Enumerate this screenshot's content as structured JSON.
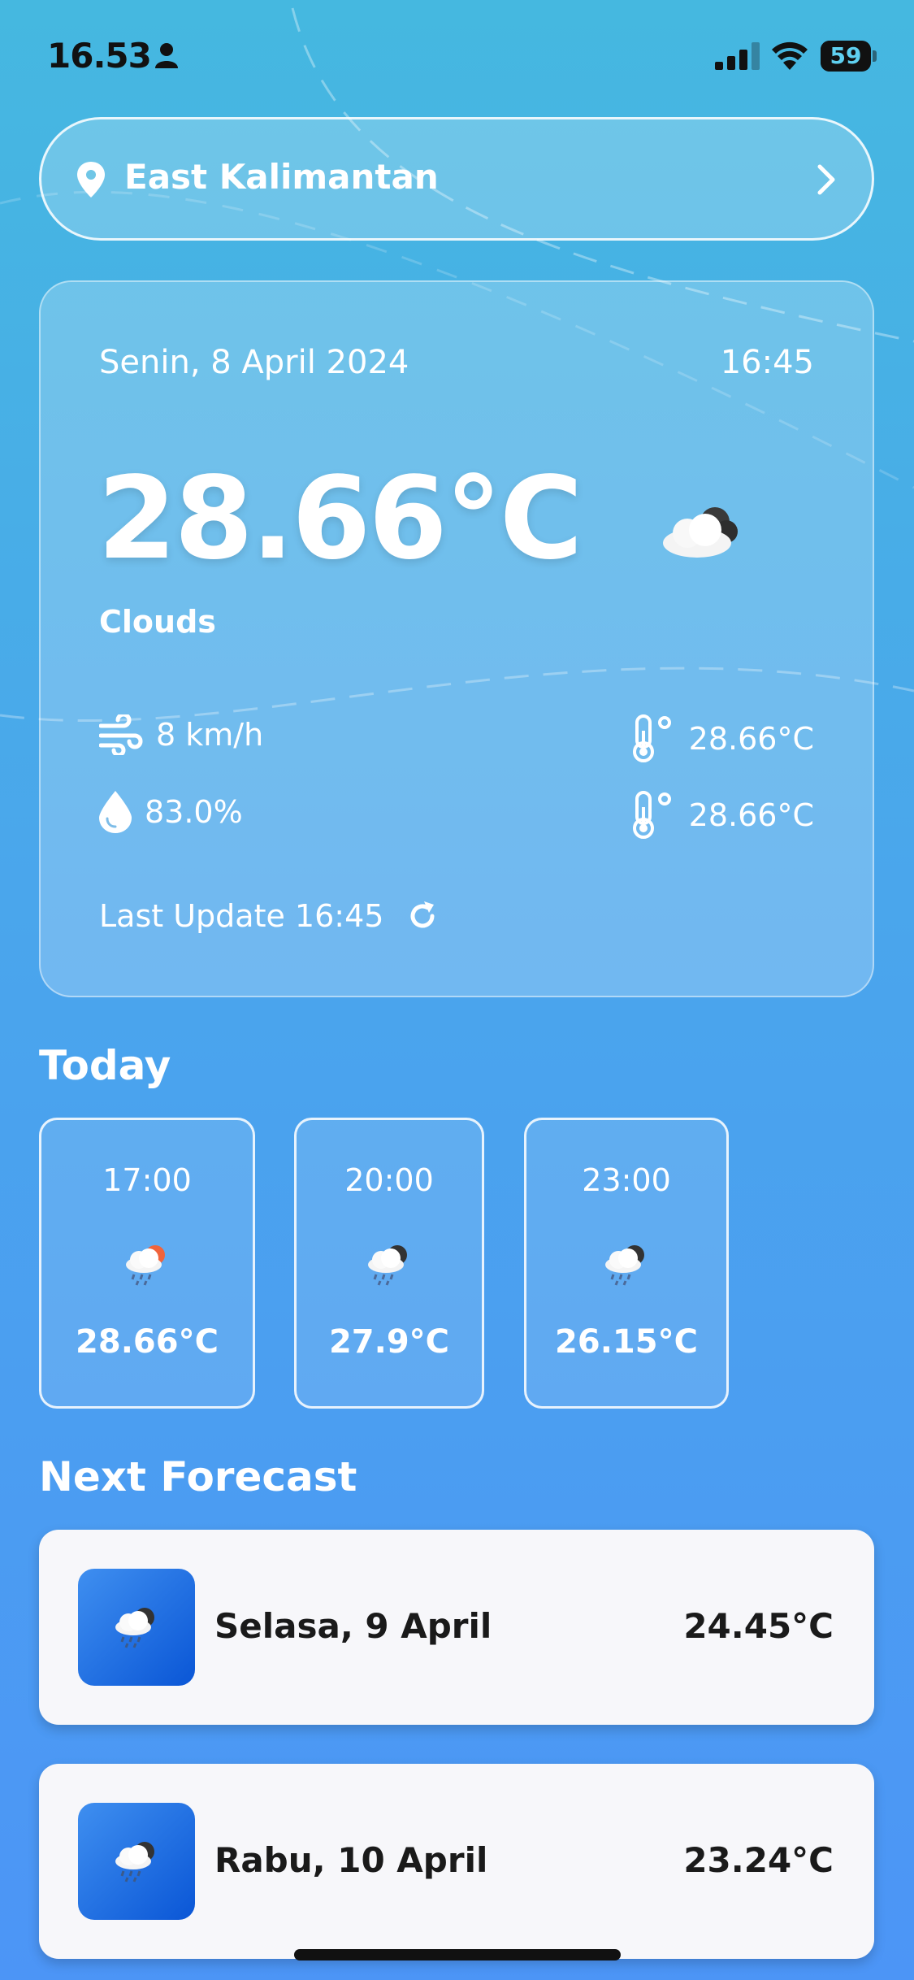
{
  "status_bar": {
    "time": "16.53",
    "battery": "59",
    "battery_level": 0.59
  },
  "location": {
    "name": "East Kalimantan"
  },
  "current": {
    "date": "Senin, 8 April 2024",
    "time": "16:45",
    "temperature": "28.66°C",
    "condition": "Clouds",
    "wind": "8 km/h",
    "humidity": "83.0%",
    "temp_max": "28.66°C",
    "temp_min": "28.66°C",
    "last_update": "Last Update 16:45",
    "icon": "cloud-moon-icon"
  },
  "today": {
    "title": "Today",
    "hours": [
      {
        "time": "17:00",
        "temp": "28.66°C",
        "icon": "cloud-sun-rain-icon"
      },
      {
        "time": "20:00",
        "temp": "27.9°C",
        "icon": "cloud-moon-rain-icon"
      },
      {
        "time": "23:00",
        "temp": "26.15°C",
        "icon": "cloud-moon-rain-icon"
      }
    ]
  },
  "forecast": {
    "title": "Next Forecast",
    "days": [
      {
        "day": "Selasa, 9 April",
        "temp": "24.45°C",
        "icon": "cloud-moon-rain-icon"
      },
      {
        "day": "Rabu, 10 April",
        "temp": "23.24°C",
        "icon": "cloud-moon-rain-icon"
      }
    ]
  },
  "colors": {
    "bg_top": "#45b8e0",
    "bg_bottom": "#4c95f6",
    "icon_box_start": "#3f8ff0",
    "icon_box_end": "#0a56d6",
    "card_text": "#1a1a1a"
  }
}
